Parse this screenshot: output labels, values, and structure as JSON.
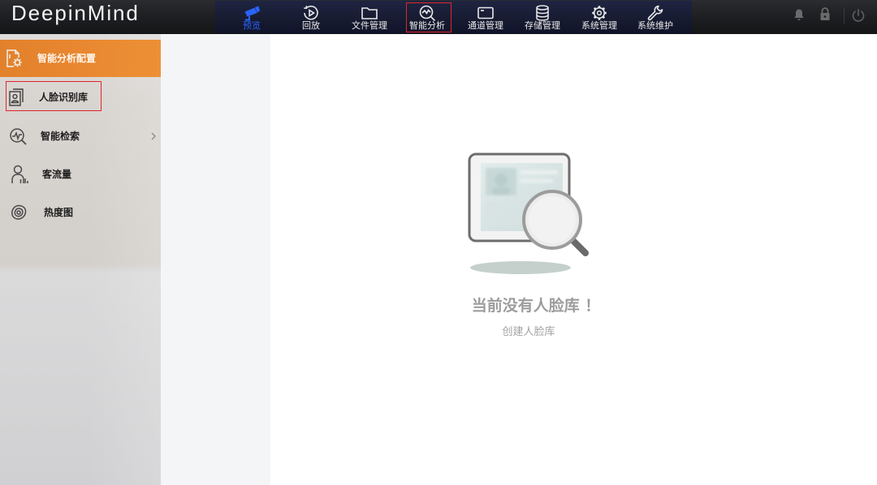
{
  "app": {
    "logo_text": "DeepinMind"
  },
  "nav": {
    "items": [
      {
        "label": "预览",
        "icon": "camera-icon",
        "active": true
      },
      {
        "label": "回放",
        "icon": "playback-icon"
      },
      {
        "label": "文件管理",
        "icon": "folder-icon"
      },
      {
        "label": "智能分析",
        "icon": "smart-analysis-icon",
        "highlighted": true
      },
      {
        "label": "通道管理",
        "icon": "channel-icon"
      },
      {
        "label": "存储管理",
        "icon": "database-icon"
      },
      {
        "label": "系统管理",
        "icon": "gear-icon"
      },
      {
        "label": "系统维护",
        "icon": "wrench-icon"
      }
    ]
  },
  "header_actions": {
    "icons": [
      "bell-icon",
      "lock-icon",
      "power-icon"
    ]
  },
  "sidebar": {
    "items": [
      {
        "label": "智能分析配置",
        "icon": "config-icon",
        "selected": true
      },
      {
        "label": "人脸识别库",
        "icon": "face-library-icon",
        "highlighted": true
      },
      {
        "label": "智能检索",
        "icon": "smart-search-icon",
        "has_submenu": true
      },
      {
        "label": "客流量",
        "icon": "people-flow-icon"
      },
      {
        "label": "热度图",
        "icon": "heatmap-icon"
      }
    ]
  },
  "main": {
    "empty_state": {
      "illustration": "empty-search-illustration",
      "message": "当前没有人脸库 ！",
      "create_label": "创建人脸库"
    }
  },
  "colors": {
    "header_bg": "#1f2023",
    "nav_bg": "#161b30",
    "active": "#2a63ff",
    "highlight_box": "#e0252b",
    "sidebar_selected": "#e8862f",
    "muted_text": "#9c9c9c"
  }
}
